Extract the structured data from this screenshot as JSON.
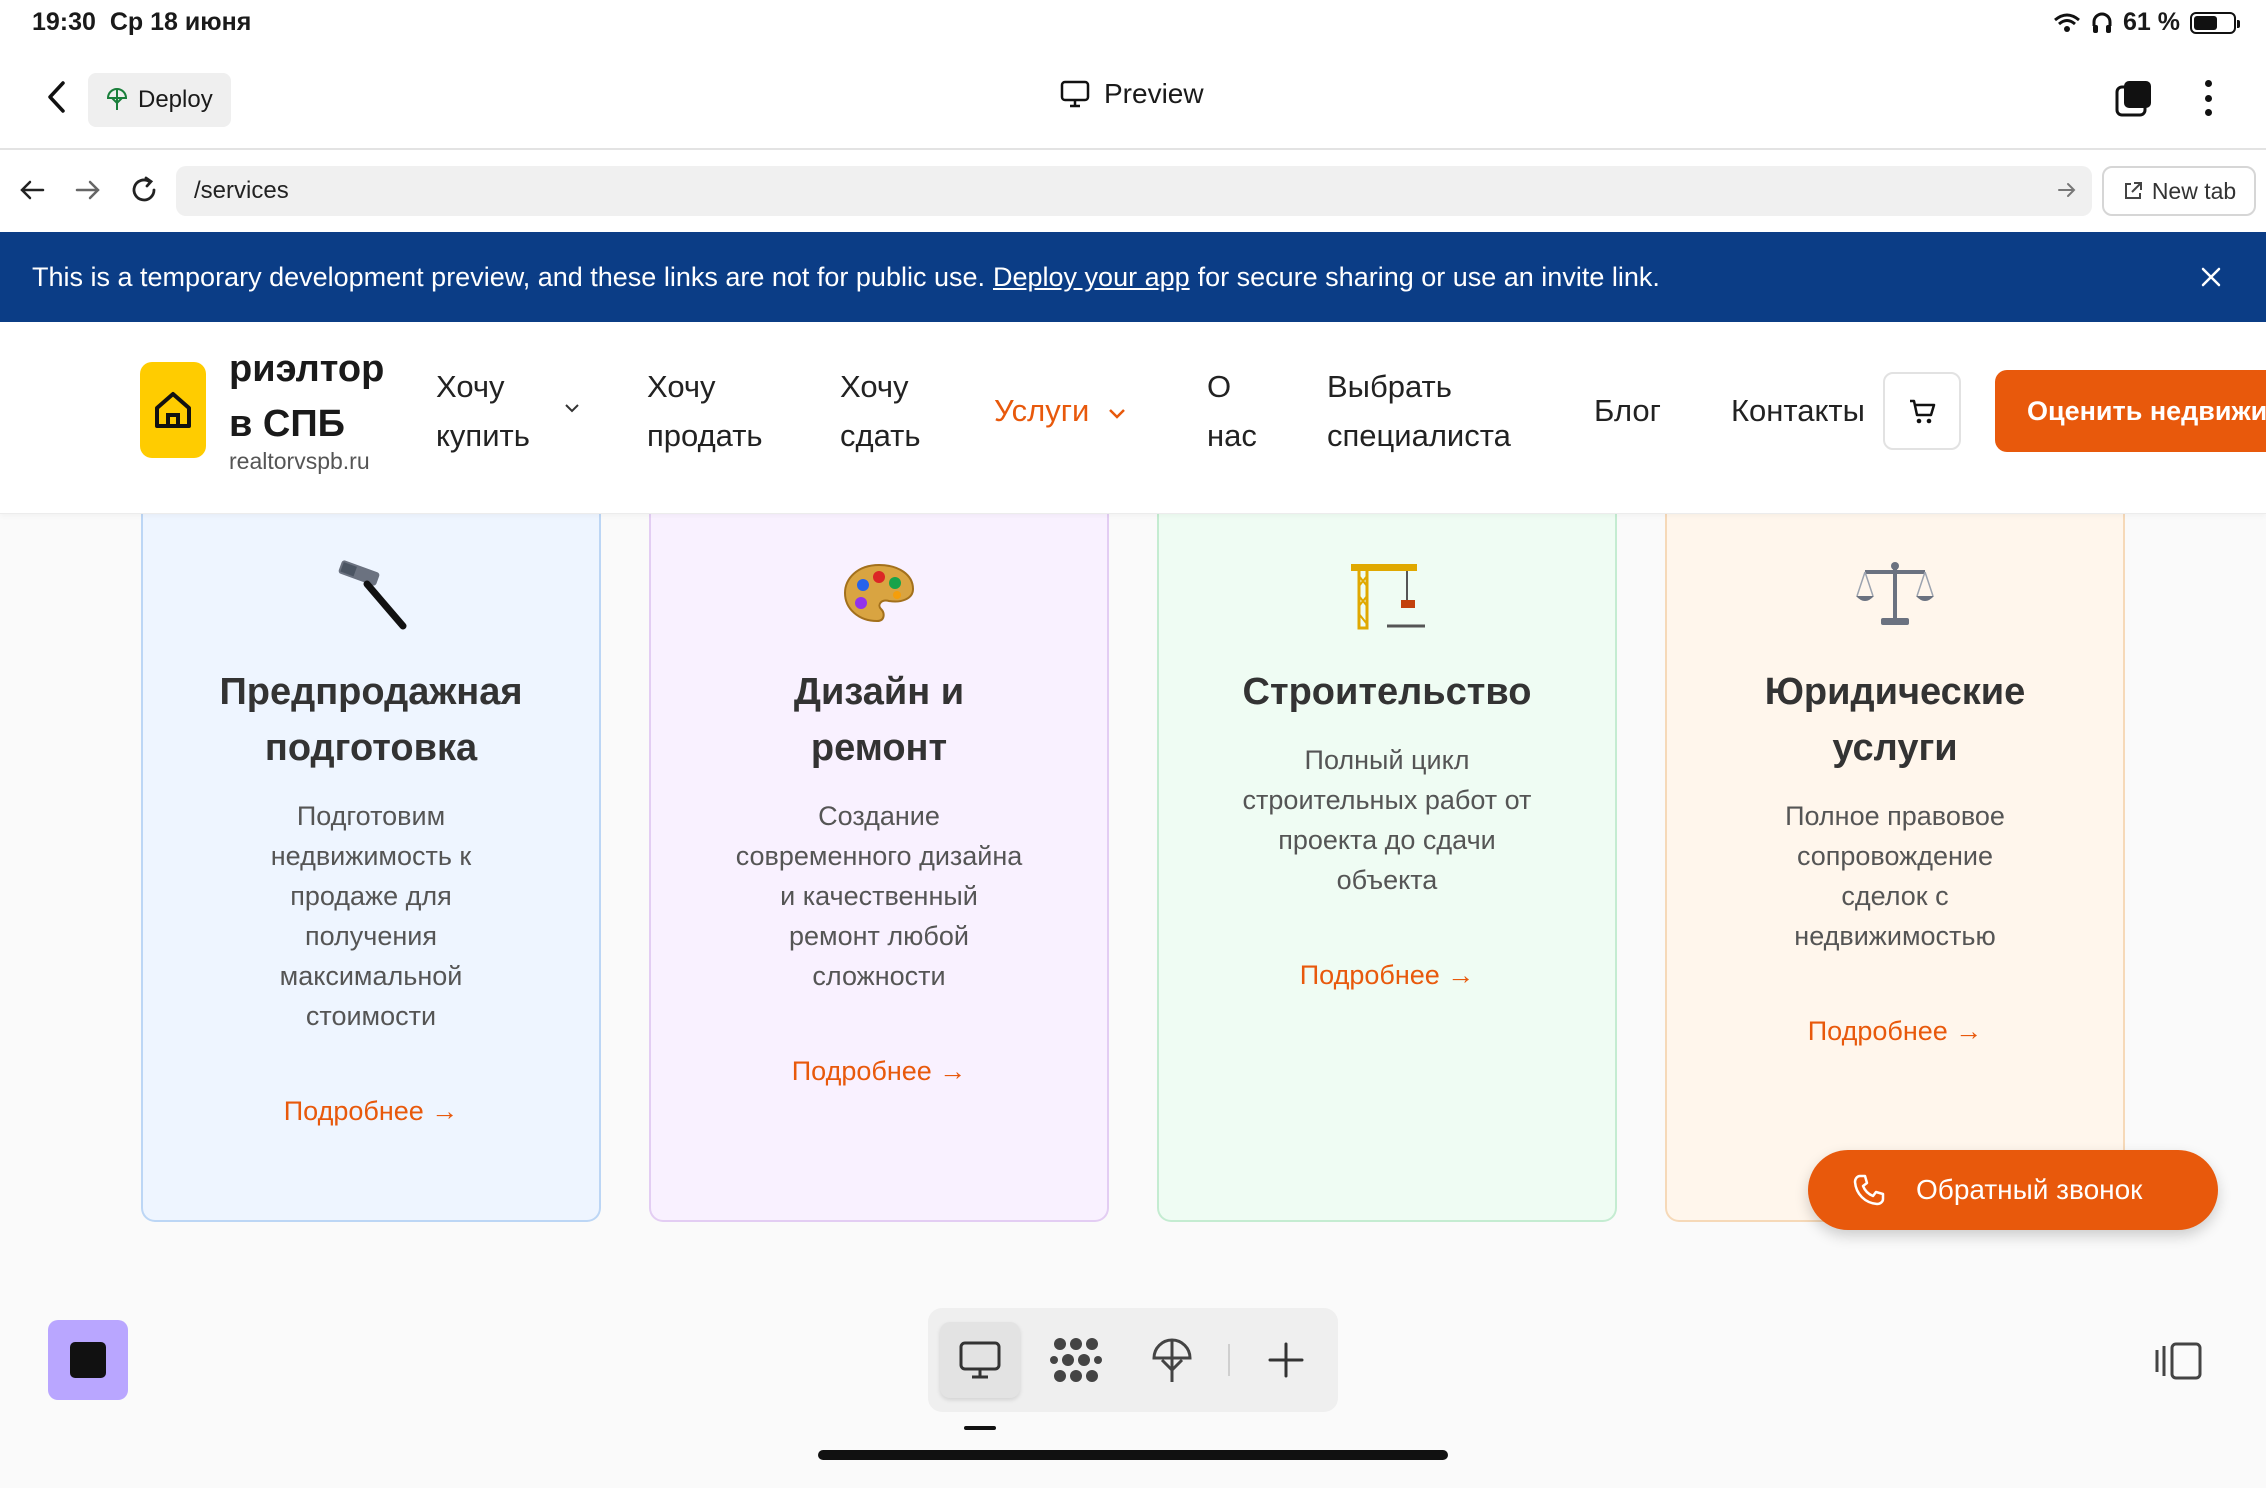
{
  "status": {
    "time": "19:30",
    "date": "Ср 18 июня",
    "battery_text": "61 %",
    "battery_level": 0.61
  },
  "appbar": {
    "deploy_label": "Deploy",
    "title": "Preview"
  },
  "browser": {
    "url": "/services",
    "new_tab_label": "New tab"
  },
  "banner": {
    "text_before": "This is a temporary development preview, and these links are not for public use.",
    "link": "Deploy your app",
    "text_after": "for secure sharing or use an invite link."
  },
  "site": {
    "logo_title_line1": "риэлтор",
    "logo_title_line2": "в СПБ",
    "logo_domain": "realtorvspb.ru",
    "nav": {
      "buy_line1": "Хочу",
      "buy_line2": "купить",
      "sell_line1": "Хочу",
      "sell_line2": "продать",
      "rent_line1": "Хочу",
      "rent_line2": "сдать",
      "services": "Услуги",
      "about_line1": "О",
      "about_line2": "нас",
      "specialist_line1": "Выбрать",
      "specialist_line2": "специалиста",
      "blog": "Блог",
      "contacts": "Контакты"
    },
    "cta": "Оценить недвижимость",
    "accent_color": "#e8590c",
    "cards": [
      {
        "title_line1": "Предпродажная",
        "title_line2": "подготовка",
        "desc": [
          "Подготовим",
          "недвижимость к",
          "продаже для",
          "получения",
          "максимальной",
          "стоимости"
        ],
        "more": "Подробнее →",
        "icon": "hammer-icon",
        "bg": "#eef5ff",
        "border": "#bcd6f5"
      },
      {
        "title_line1": "Дизайн и",
        "title_line2": "ремонт",
        "desc": [
          "Создание",
          "современного дизайна",
          "и качественный",
          "ремонт любой",
          "сложности"
        ],
        "more": "Подробнее →",
        "icon": "palette-icon",
        "bg": "#f9f1ff",
        "border": "#e3cdf3"
      },
      {
        "title_line1": "Строительство",
        "desc": [
          "Полный цикл",
          "строительных работ от",
          "проекта до сдачи",
          "объекта"
        ],
        "more": "Подробнее →",
        "icon": "crane-icon",
        "bg": "#effcf3",
        "border": "#c4ecd1"
      },
      {
        "title_line1": "Юридические",
        "title_line2": "услуги",
        "desc": [
          "Полное правовое",
          "сопровождение",
          "сделок с",
          "недвижимостью"
        ],
        "more": "Подробнее →",
        "icon": "scales-icon",
        "bg": "#fff6ec",
        "border": "#f6d9b8"
      }
    ],
    "callback": "Обратный звонок"
  }
}
